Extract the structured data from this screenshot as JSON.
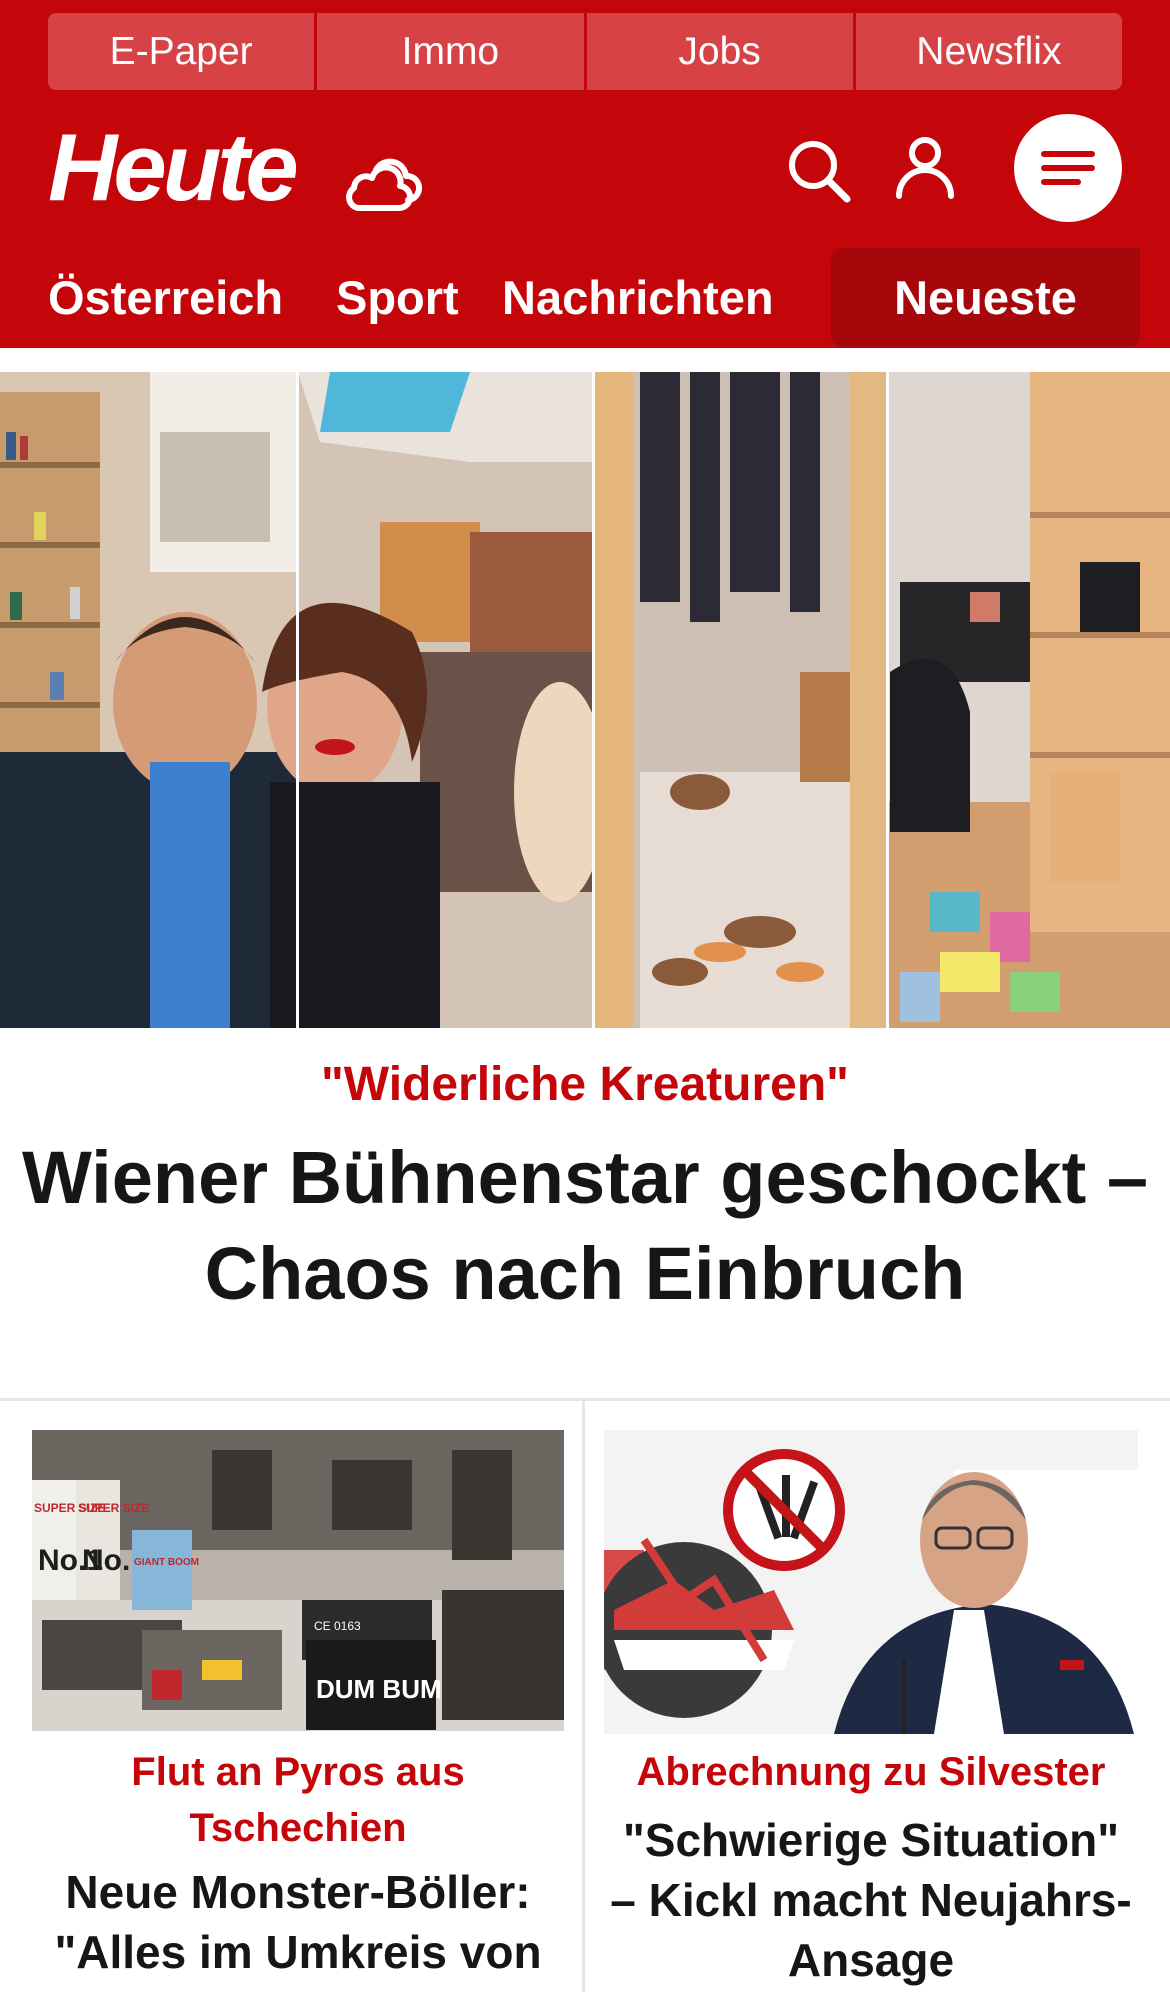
{
  "topbar": {
    "links": [
      "E-Paper",
      "Immo",
      "Jobs",
      "Newsflix"
    ]
  },
  "header": {
    "logo": "Heute",
    "icons": [
      "weather-cloud-icon",
      "search-icon",
      "user-icon",
      "menu-icon"
    ]
  },
  "nav": {
    "items": [
      "Österreich",
      "Sport",
      "Nachrichten"
    ],
    "highlight": "Neueste"
  },
  "hero": {
    "kicker": "\"Widerliche Kreaturen\"",
    "title": "Wiener Bühnenstar geschockt – Chaos nach Einbruch"
  },
  "teasers": [
    {
      "kicker": "Flut an Pyros aus Tschechien",
      "title": "Neue Monster-Böller: \"Alles im Umkreis von",
      "image_text": [
        "SUPER SIZE",
        "SUPER SIZE",
        "No.1",
        "No.1",
        "GIANT BOOM",
        "DUM BUM",
        "CE 0163"
      ]
    },
    {
      "kicker": "Abrechnung zu Silvester",
      "title": "\"Schwierige Situation\" – Kickl macht Neujahrs-Ansage"
    }
  ],
  "colors": {
    "brand_red": "#c4050a",
    "toplink_bg": "#d74246",
    "neueste_bg": "#a6070b"
  }
}
